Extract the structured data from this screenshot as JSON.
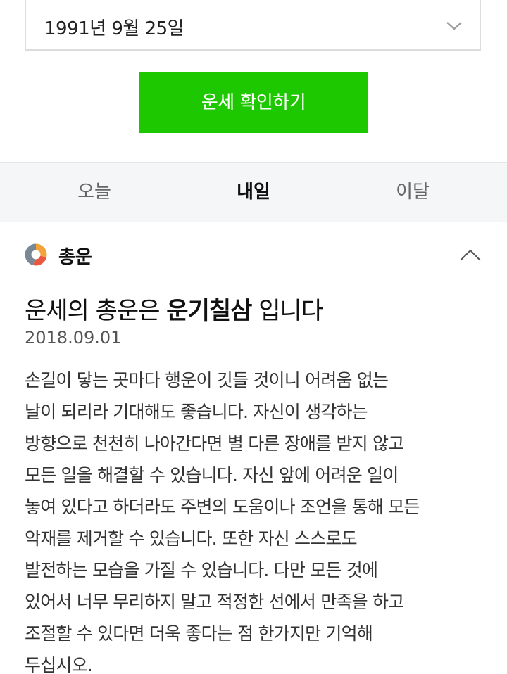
{
  "date_select": {
    "value": "1991년 9월 25일",
    "icon": "chevron-down-icon"
  },
  "confirm_button": {
    "label": "운세 확인하기",
    "color": "#1ec800"
  },
  "tabs": [
    {
      "label": "오늘",
      "active": false
    },
    {
      "label": "내일",
      "active": true
    },
    {
      "label": "이달",
      "active": false
    }
  ],
  "section": {
    "title": "총운",
    "icon": "donut-chart-icon",
    "collapse_icon": "chevron-up-icon"
  },
  "fortune": {
    "headline_prefix": "운세의 총운은 ",
    "headline_keyword": "운기칠삼",
    "headline_suffix": " 입니다",
    "date": "2018.09.01",
    "lines": [
      "손길이 닿는 곳마다 행운이 깃들 것이니 어려움 없는",
      "날이 되리라 기대해도 좋습니다. 자신이 생각하는",
      "방향으로 천천히 나아간다면 별 다른 장애를 받지 않고",
      "모든 일을 해결할 수 있습니다. 자신 앞에 어려운 일이",
      "놓여 있다고 하더라도 주변의 도움이나 조언을 통해 모든",
      "악재를 제거할 수 있습니다. 또한 자신 스스로도",
      "발전하는 모습을 가질 수 있습니다. 다만 모든 것에",
      "있어서 너무 무리하지 말고 적정한 선에서 만족을 하고",
      "조절할 수 있다면 더욱 좋다는 점 한가지만 기억해",
      "두십시오."
    ]
  }
}
